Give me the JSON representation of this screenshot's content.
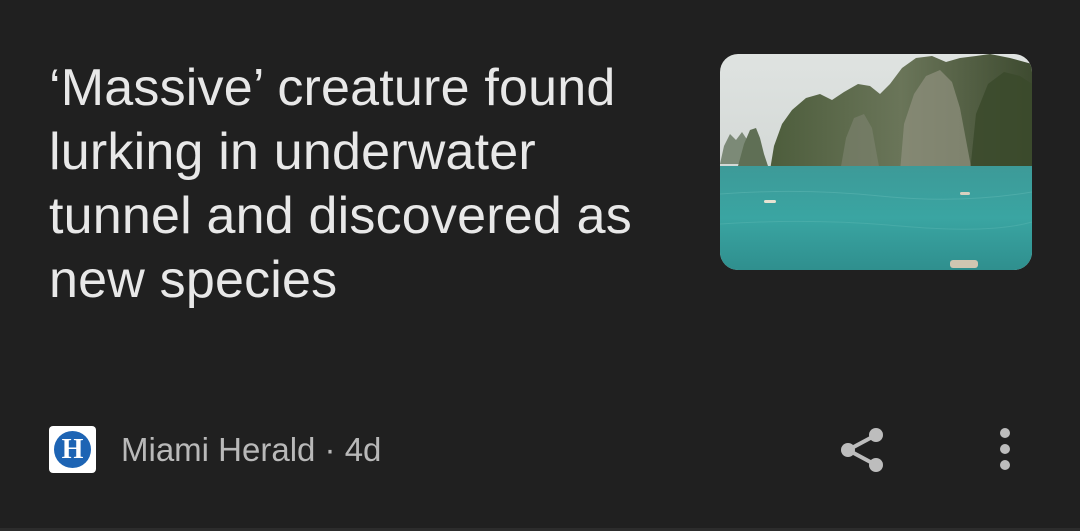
{
  "article": {
    "headline": "‘Massive’ creature found lurking in underwater tunnel and discovered as new species",
    "source_name": "Miami Herald",
    "separator": " · ",
    "age": "4d",
    "logo_letter": "H",
    "thumbnail_alt": "Limestone karst islands rising from turquoise bay"
  },
  "actions": {
    "share_icon": "share-icon",
    "more_icon": "more-vert-icon",
    "share_label": "Share",
    "more_label": "More options"
  },
  "colors": {
    "background": "#202020",
    "headline_text": "#e8e8e8",
    "meta_text": "#b9b9b9",
    "icon": "#bdbdbd",
    "logo_blue": "#1d64b4"
  }
}
